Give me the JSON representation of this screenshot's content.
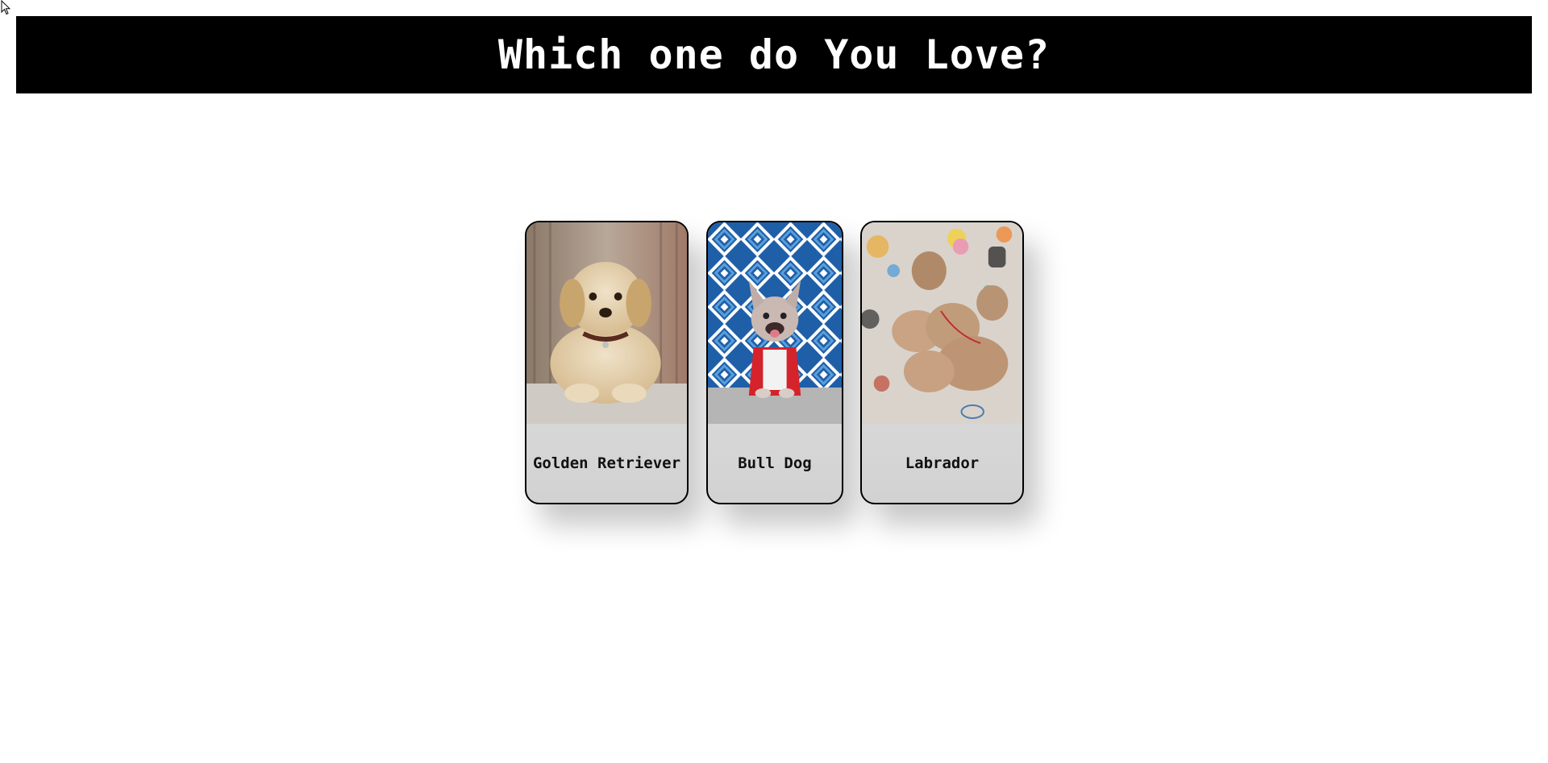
{
  "header": {
    "title": "Which one do You Love?"
  },
  "cards": [
    {
      "label": "Golden Retriever",
      "image": "golden-retriever-puppy-photo"
    },
    {
      "label": "Bull Dog",
      "image": "french-bulldog-photo"
    },
    {
      "label": "Labrador",
      "image": "labrador-puppies-photo"
    }
  ],
  "colors": {
    "header_bg": "#000000",
    "header_text": "#ffffff",
    "card_label_bg": "#d8d8d8",
    "card_border": "#000000"
  }
}
